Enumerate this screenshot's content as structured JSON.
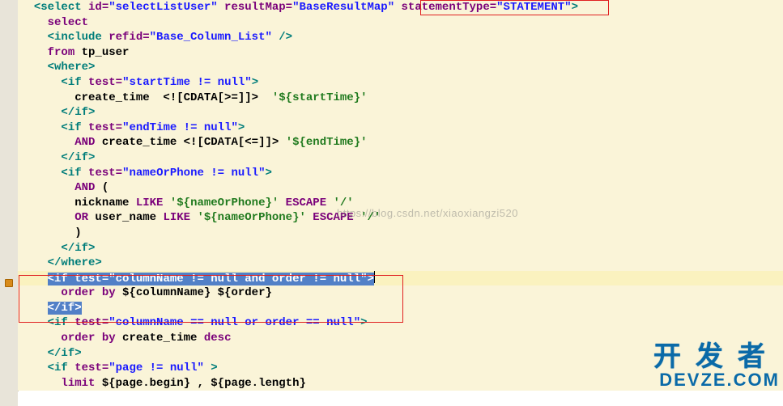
{
  "watermark": "https://blog.csdn.net/xiaoxiangzi520",
  "logo": {
    "zh": "开发者",
    "en": "DEVZE.COM"
  },
  "code": {
    "l1": {
      "pre": "  ",
      "open": "<select",
      "a1n": " id=",
      "a1v": "\"selectListUser\"",
      "a2n": " resultMap=",
      "a2v": "\"BaseResultMap\"",
      "a3n": " statementType=",
      "a3v": "\"STATEMENT\"",
      "end": ">"
    },
    "l2": {
      "pre": "    ",
      "kw": "select"
    },
    "l3": {
      "pre": "    ",
      "open": "<include",
      "a1n": " refid=",
      "a1v": "\"Base_Column_List\"",
      "end": " />"
    },
    "l4": {
      "pre": "    ",
      "kw": "from",
      "tail": " tp_user"
    },
    "l5": {
      "pre": "    ",
      "open": "<where>"
    },
    "l6": {
      "pre": "      ",
      "open": "<if",
      "a1n": " test=",
      "a1v": "\"startTime != null\"",
      "end": ">"
    },
    "l7": {
      "pre": "        ",
      "txt": "create_time  <![CDATA[>=]]>  ",
      "lit": "'${startTime}'"
    },
    "l8": {
      "pre": "      ",
      "open": "</if>"
    },
    "l9": {
      "pre": "      ",
      "open": "<if",
      "a1n": " test=",
      "a1v": "\"endTime != null\"",
      "end": ">"
    },
    "l10": {
      "pre": "        ",
      "kw": "AND",
      "txt": " create_time <![CDATA[<=]]> ",
      "lit": "'${endTime}'"
    },
    "l11": {
      "pre": "      ",
      "open": "</if>"
    },
    "l12": {
      "pre": "      ",
      "open": "<if",
      "a1n": " test=",
      "a1v": "\"nameOrPhone != null\"",
      "end": ">"
    },
    "l13": {
      "pre": "        ",
      "kw": "AND",
      "tail": " ("
    },
    "l14": {
      "pre": "        ",
      "txt": "nickname ",
      "kw": "LIKE ",
      "lit": "'${nameOrPhone}'",
      "kw2": " ESCAPE ",
      "lit2": "'/'"
    },
    "l15": {
      "pre": "        ",
      "kw0": "OR",
      "txt": " user_name ",
      "kw": "LIKE ",
      "lit": "'${nameOrPhone}'",
      "kw2": " ESCAPE ",
      "lit2": "'/'"
    },
    "l16": {
      "pre": "        ",
      "txt": ")"
    },
    "l17": {
      "pre": "      ",
      "open": "</if>"
    },
    "l18": {
      "pre": "    ",
      "open": "</where>"
    },
    "l19": {
      "pre": "    ",
      "open": "<if",
      "a1n": " test=",
      "a1v": "\"columnName != null and order != null\"",
      "end": ">"
    },
    "l20": {
      "pre": "      ",
      "kw": "order by",
      "tail": " ${columnName} ${order}"
    },
    "l21": {
      "pre": "    ",
      "open": "</if>"
    },
    "l22": {
      "pre": "    ",
      "open": "<if",
      "a1n": " test=",
      "a1v": "\"columnName == null or order == null\"",
      "end": ">"
    },
    "l23": {
      "pre": "      ",
      "kw": "order by",
      "txt": " create_time ",
      "kw2": "desc"
    },
    "l24": {
      "pre": "    ",
      "open": "</if>"
    },
    "l25": {
      "pre": "    ",
      "open": "<if",
      "a1n": " test=",
      "a1v": "\"page != null\"",
      "end": " >"
    },
    "l26": {
      "pre": "      ",
      "kw": "limit",
      "tail": " ${page.begin} , ${page.length}"
    }
  }
}
